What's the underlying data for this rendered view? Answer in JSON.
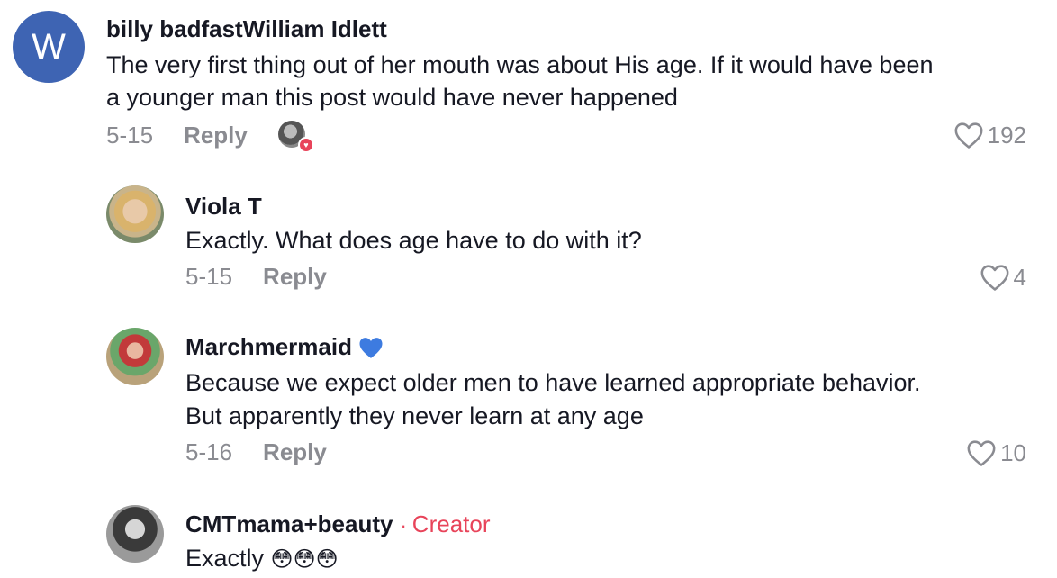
{
  "comments": [
    {
      "avatar_letter": "W",
      "author": "billy badfastWilliam Idlett",
      "text_lines": [
        "The very first thing out of her mouth was about His age. If it would have been",
        "a younger man this post would have never happened"
      ],
      "date": "5-15",
      "reply_label": "Reply",
      "likes": "192"
    },
    {
      "author": "Viola T",
      "text_lines": [
        "Exactly. What does age have to do with it?"
      ],
      "date": "5-15",
      "reply_label": "Reply",
      "likes": "4"
    },
    {
      "author": "Marchmermaid",
      "author_emoji": "💙",
      "text_lines": [
        "Because we expect older men to have learned appropriate behavior.",
        "But apparently they never learn at any age"
      ],
      "date": "5-16",
      "reply_label": "Reply",
      "likes": "10"
    },
    {
      "author": "CMTmama+beauty",
      "creator_separator": "·",
      "creator_label": "Creator",
      "text": "Exactly",
      "text_emoji": "😳😳😳"
    }
  ],
  "colors": {
    "text": "#161823",
    "muted": "#8a8b91",
    "creator": "#e8445a",
    "avatar_bg": "#3e64b3"
  }
}
